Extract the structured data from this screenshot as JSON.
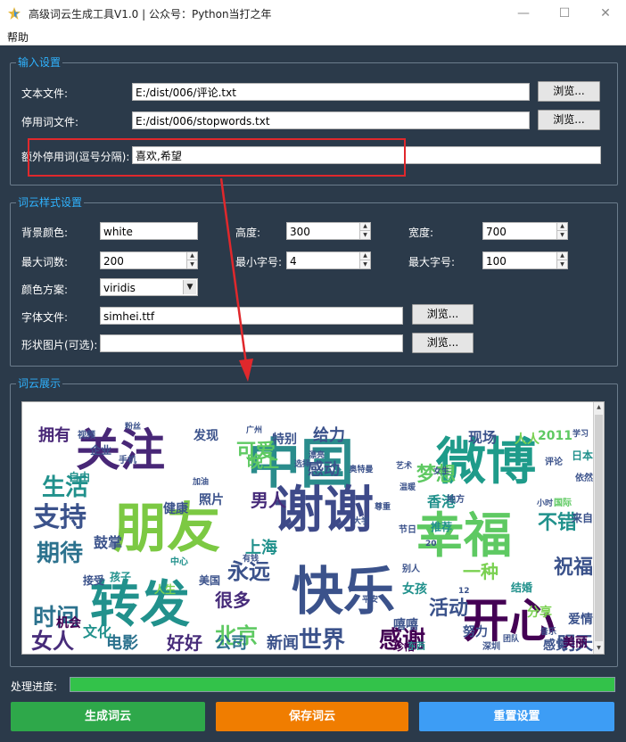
{
  "window": {
    "title": "高级词云生成工具V1.0 | 公众号：Python当打之年"
  },
  "menu": {
    "help": "帮助"
  },
  "input_group": {
    "title": "输入设置",
    "text_file_label": "文本文件:",
    "text_file_value": "E:/dist/006/评论.txt",
    "stopwords_label": "停用词文件:",
    "stopwords_value": "E:/dist/006/stopwords.txt",
    "extra_label": "额外停用词(逗号分隔):",
    "extra_value": "喜欢,希望",
    "browse": "浏览..."
  },
  "style_group": {
    "title": "词云样式设置",
    "bg_label": "背景颜色:",
    "bg_value": "white",
    "height_label": "高度:",
    "height_value": "300",
    "width_label": "宽度:",
    "width_value": "700",
    "max_words_label": "最大词数:",
    "max_words_value": "200",
    "min_font_label": "最小字号:",
    "min_font_value": "4",
    "max_font_label": "最大字号:",
    "max_font_value": "100",
    "colormap_label": "颜色方案:",
    "colormap_value": "viridis",
    "font_label": "字体文件:",
    "font_value": "simhei.ttf",
    "mask_label": "形状图片(可选):",
    "mask_value": "",
    "browse": "浏览..."
  },
  "display_group": {
    "title": "词云展示",
    "words": [
      {
        "t": "中国",
        "size": 60,
        "color": "#2a8c8c"
      },
      {
        "t": "微博",
        "size": 56,
        "color": "#1e9b8a"
      },
      {
        "t": "朋友",
        "size": 60,
        "color": "#7cc943"
      },
      {
        "t": "谢谢",
        "size": 56,
        "color": "#3e4a89"
      },
      {
        "t": "幸福",
        "size": 54,
        "color": "#5ec962"
      },
      {
        "t": "关注",
        "size": 50,
        "color": "#482777"
      },
      {
        "t": "转发",
        "size": 56,
        "color": "#21918c"
      },
      {
        "t": "快乐",
        "size": 58,
        "color": "#3b528b"
      },
      {
        "t": "开心",
        "size": 52,
        "color": "#440154"
      },
      {
        "t": "支持",
        "size": 30,
        "color": "#3b528b"
      },
      {
        "t": "期待",
        "size": 26,
        "color": "#2c728e"
      },
      {
        "t": "生活",
        "size": 26,
        "color": "#21918c"
      },
      {
        "t": "时间",
        "size": 26,
        "color": "#2c728e"
      },
      {
        "t": "女人",
        "size": 24,
        "color": "#472c7a"
      },
      {
        "t": "世界",
        "size": 26,
        "color": "#3b528b"
      },
      {
        "t": "感谢",
        "size": 26,
        "color": "#440154"
      },
      {
        "t": "北京",
        "size": 24,
        "color": "#5ec962"
      },
      {
        "t": "永远",
        "size": 24,
        "color": "#3b528b"
      },
      {
        "t": "男人",
        "size": 20,
        "color": "#472c7a"
      },
      {
        "t": "可爱",
        "size": 22,
        "color": "#5ec962"
      },
      {
        "t": "感动",
        "size": 18,
        "color": "#3b528b"
      },
      {
        "t": "梦想",
        "size": 22,
        "color": "#5ec962"
      },
      {
        "t": "一种",
        "size": 20,
        "color": "#7ad151"
      },
      {
        "t": "不错",
        "size": 22,
        "color": "#21918c"
      },
      {
        "t": "祝福",
        "size": 22,
        "color": "#3b528b"
      },
      {
        "t": "明天",
        "size": 20,
        "color": "#3b528b"
      },
      {
        "t": "活动",
        "size": 22,
        "color": "#3b528b"
      },
      {
        "t": "很多",
        "size": 20,
        "color": "#472c7a"
      },
      {
        "t": "好好",
        "size": 20,
        "color": "#472c7a"
      },
      {
        "t": "公司",
        "size": 18,
        "color": "#2c728e"
      },
      {
        "t": "新闻",
        "size": 18,
        "color": "#3b528b"
      },
      {
        "t": "电影",
        "size": 18,
        "color": "#2c728e"
      },
      {
        "t": "文化",
        "size": 16,
        "color": "#21918c"
      },
      {
        "t": "拥有",
        "size": 18,
        "color": "#482777"
      },
      {
        "t": "鼓掌",
        "size": 16,
        "color": "#3b528b"
      },
      {
        "t": "给力",
        "size": 18,
        "color": "#3b528b"
      },
      {
        "t": "现场",
        "size": 16,
        "color": "#3b528b"
      },
      {
        "t": "人人",
        "size": 14,
        "color": "#7ad151"
      },
      {
        "t": "2011",
        "size": 14,
        "color": "#5ec962"
      },
      {
        "t": "香港",
        "size": 16,
        "color": "#21918c"
      },
      {
        "t": "晚上",
        "size": 18,
        "color": "#5ec962"
      },
      {
        "t": "上海",
        "size": 18,
        "color": "#21918c"
      },
      {
        "t": "发现",
        "size": 14,
        "color": "#3b528b"
      },
      {
        "t": "特别",
        "size": 14,
        "color": "#3b528b"
      },
      {
        "t": "照片",
        "size": 14,
        "color": "#3b528b"
      },
      {
        "t": "健康",
        "size": 14,
        "color": "#3b528b"
      },
      {
        "t": "机会",
        "size": 14,
        "color": "#440154"
      },
      {
        "t": "美国",
        "size": 12,
        "color": "#3b528b"
      },
      {
        "t": "人生",
        "size": 12,
        "color": "#7ad151"
      },
      {
        "t": "孩子",
        "size": 12,
        "color": "#21918c"
      },
      {
        "t": "爱情",
        "size": 14,
        "color": "#3b528b"
      },
      {
        "t": "日本",
        "size": 12,
        "color": "#21918c"
      },
      {
        "t": "感觉",
        "size": 14,
        "color": "#3b528b"
      },
      {
        "t": "努力",
        "size": 14,
        "color": "#3b528b"
      },
      {
        "t": "分享",
        "size": 14,
        "color": "#7ad151"
      },
      {
        "t": "女孩",
        "size": 14,
        "color": "#21918c"
      },
      {
        "t": "嘻嘻",
        "size": 14,
        "color": "#3b528b"
      },
      {
        "t": "美丽",
        "size": 14,
        "color": "#440154"
      },
      {
        "t": "企业",
        "size": 12,
        "color": "#3b528b"
      },
      {
        "t": "接受",
        "size": 12,
        "color": "#3b528b"
      },
      {
        "t": "自由",
        "size": 12,
        "color": "#21918c"
      },
      {
        "t": "视频",
        "size": 10,
        "color": "#3b528b"
      },
      {
        "t": "手机",
        "size": 10,
        "color": "#3b528b"
      },
      {
        "t": "结婚",
        "size": 12,
        "color": "#21918c"
      },
      {
        "t": "珍惜",
        "size": 12,
        "color": "#440154"
      },
      {
        "t": "推荐",
        "size": 12,
        "color": "#21918c"
      },
      {
        "t": "中心",
        "size": 10,
        "color": "#21918c"
      },
      {
        "t": "地方",
        "size": 10,
        "color": "#3b528b"
      },
      {
        "t": "节日",
        "size": 10,
        "color": "#3b528b"
      },
      {
        "t": "来自",
        "size": 12,
        "color": "#3b528b"
      },
      {
        "t": "国际",
        "size": 10,
        "color": "#5ec962"
      },
      {
        "t": "深圳",
        "size": 10,
        "color": "#3b528b"
      },
      {
        "t": "东西",
        "size": 10,
        "color": "#21918c"
      },
      {
        "t": "别人",
        "size": 10,
        "color": "#3b528b"
      },
      {
        "t": "依然",
        "size": 10,
        "color": "#3b528b"
      },
      {
        "t": "评论",
        "size": 10,
        "color": "#3b528b"
      },
      {
        "t": "大学",
        "size": 9,
        "color": "#3b528b"
      },
      {
        "t": "女生",
        "size": 9,
        "color": "#3b528b"
      },
      {
        "t": "有钱",
        "size": 9,
        "color": "#3b528b"
      },
      {
        "t": "平安",
        "size": 9,
        "color": "#3b528b"
      },
      {
        "t": "加油",
        "size": 9,
        "color": "#3b528b"
      },
      {
        "t": "艺术",
        "size": 9,
        "color": "#3b528b"
      },
      {
        "t": "音乐",
        "size": 9,
        "color": "#3b528b"
      },
      {
        "t": "团队",
        "size": 9,
        "color": "#3b528b"
      },
      {
        "t": "尊重",
        "size": 9,
        "color": "#3b528b"
      },
      {
        "t": "广州",
        "size": 9,
        "color": "#3b528b"
      },
      {
        "t": "选择",
        "size": 9,
        "color": "#3b528b"
      },
      {
        "t": "奥特曼",
        "size": 9,
        "color": "#3b528b"
      },
      {
        "t": "温暖",
        "size": 9,
        "color": "#3b528b"
      },
      {
        "t": "小时",
        "size": 9,
        "color": "#3b528b"
      },
      {
        "t": "学习",
        "size": 9,
        "color": "#3b528b"
      },
      {
        "t": "漂亮",
        "size": 9,
        "color": "#3b528b"
      },
      {
        "t": "粉丝",
        "size": 9,
        "color": "#3b528b"
      },
      {
        "t": "20",
        "size": 9,
        "color": "#3b528b"
      },
      {
        "t": "12",
        "size": 9,
        "color": "#3b528b"
      }
    ]
  },
  "progress": {
    "label": "处理进度:",
    "value": 1.0
  },
  "actions": {
    "generate": "生成词云",
    "save": "保存词云",
    "reset": "重置设置"
  },
  "colors": {
    "generate": "#2ea84a",
    "save": "#f07d00",
    "reset": "#3d9df5",
    "accent": "#2fb3ff",
    "highlight": "#e0282c"
  }
}
